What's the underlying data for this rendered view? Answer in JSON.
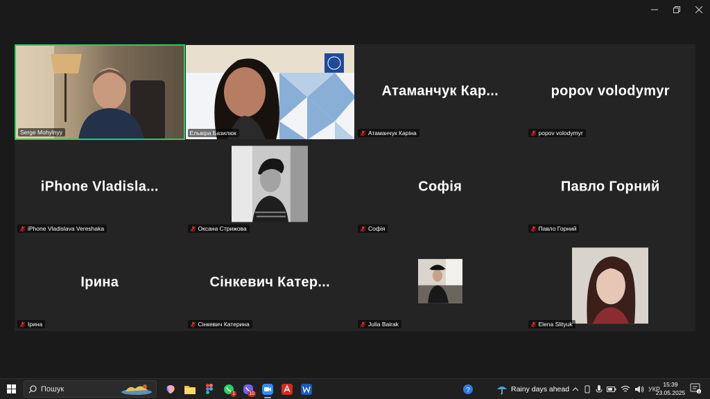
{
  "window": {
    "controls": [
      "minimize",
      "restore",
      "close"
    ]
  },
  "participants": [
    {
      "name": "Serge Mohylnyy",
      "display": "",
      "video": true,
      "muted": false,
      "active": true
    },
    {
      "name": "Ельвіра Базилюк",
      "display": "",
      "video": true,
      "muted": false,
      "active": false
    },
    {
      "name": "Атаманчук Каріна",
      "display": "Атаманчук  Кар...",
      "video": false,
      "muted": true
    },
    {
      "name": "popov volodymyr",
      "display": "popov volodymyr",
      "video": false,
      "muted": true
    },
    {
      "name": "iPhone Vladislava Vereshaka",
      "display": "iPhone  Vladisla...",
      "video": false,
      "muted": true
    },
    {
      "name": "Оксана Стрижова",
      "display": "",
      "video": false,
      "photo": true,
      "muted": true
    },
    {
      "name": "Софія",
      "display": "Софія",
      "video": false,
      "muted": true
    },
    {
      "name": "Павло Горний",
      "display": "Павло Горний",
      "video": false,
      "muted": true
    },
    {
      "name": "Ірина",
      "display": "Ірина",
      "video": false,
      "muted": true
    },
    {
      "name": "Сінкевич Катерина",
      "display": "Сінкевич  Катер...",
      "video": false,
      "muted": true
    },
    {
      "name": "Julia Bairak",
      "display": "",
      "video": false,
      "photo": true,
      "muted": true
    },
    {
      "name": "Elena Slityuk",
      "display": "",
      "video": false,
      "photo": true,
      "muted": true
    }
  ],
  "taskbar": {
    "search_placeholder": "Пошук",
    "apps": [
      "copilot",
      "file-explorer",
      "figma",
      "whatsapp",
      "viber",
      "zoom",
      "acrobat",
      "word"
    ],
    "whatsapp_badge": "1",
    "viber_badge": "10",
    "weather": "Rainy days ahead",
    "language": "УКР",
    "time": "15:39",
    "date": "23.05.2025"
  },
  "colors": {
    "active_border": "#23d160",
    "tile_bg": "#242424",
    "muted_mic": "#e02828"
  }
}
